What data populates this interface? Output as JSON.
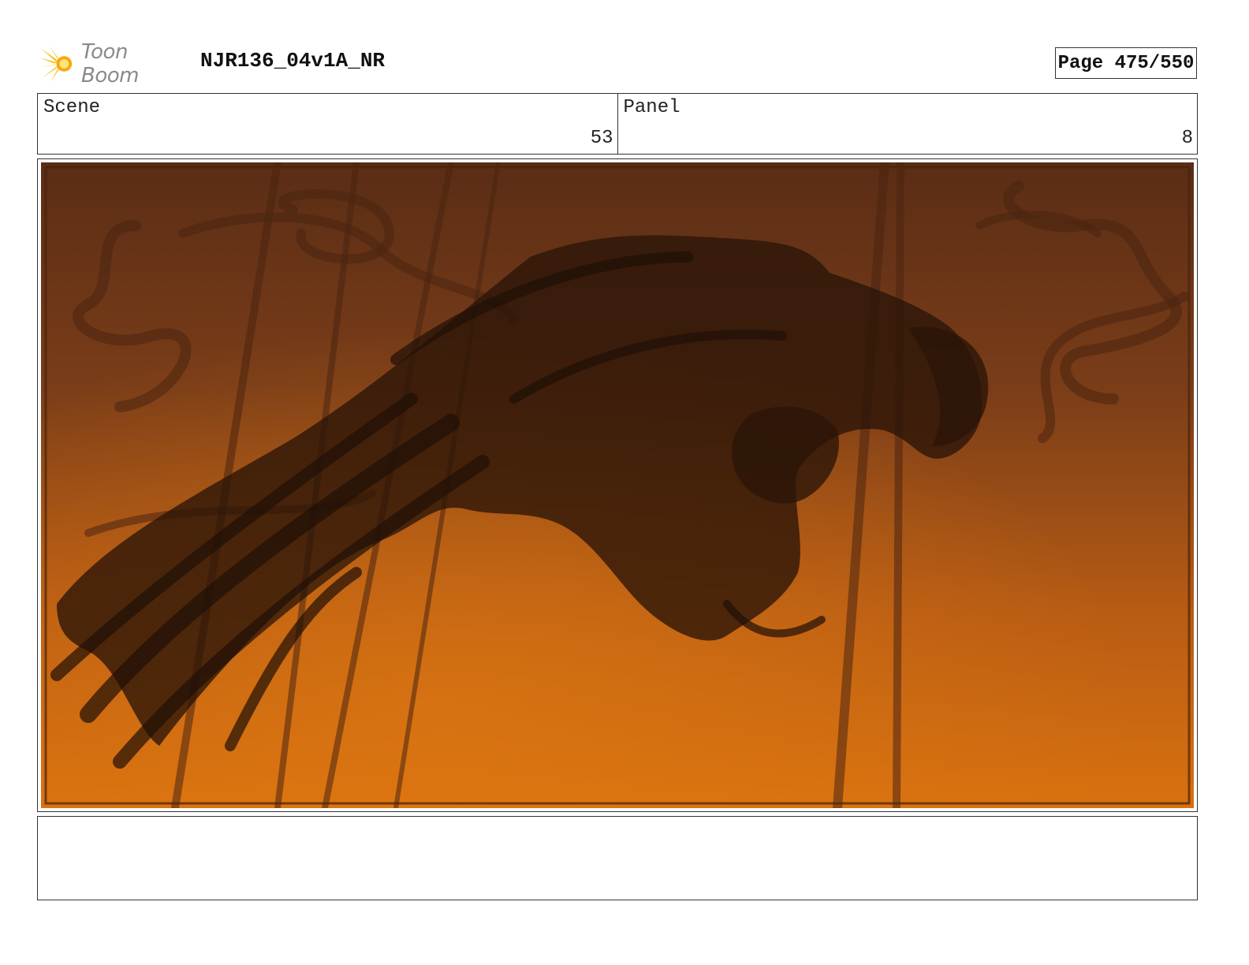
{
  "header": {
    "logo_text": "Toon Boom",
    "document_title": "NJR136_04v1A_NR",
    "page_label": "Page 475/550"
  },
  "info": {
    "scene_label": "Scene",
    "scene_value": "53",
    "panel_label": "Panel",
    "panel_value": "8"
  },
  "panel_image": {
    "icon": "storyboard-sketch",
    "colors": {
      "sky_top": "#5a2d16",
      "sky_bottom": "#d9710f",
      "silhouette": "#2a1408"
    }
  },
  "notes": {
    "text": ""
  }
}
